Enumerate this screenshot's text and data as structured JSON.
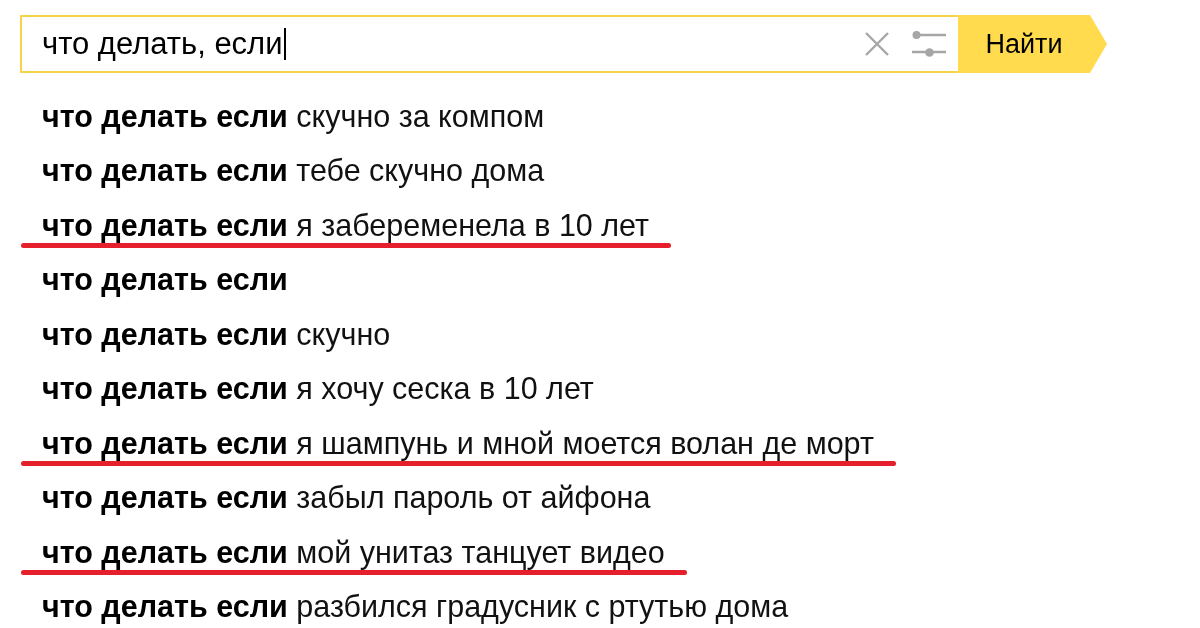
{
  "search": {
    "value": "что делать, если",
    "button": "Найти"
  },
  "suggestions": [
    {
      "text": "**что делать если** скучно за компом",
      "underlined": false
    },
    {
      "text": "**что делать если** тебе скучно дома",
      "underlined": false
    },
    {
      "text": "**что делать если** я забеременела в 10 лет",
      "underlined": true
    },
    {
      "text": "**что делать если**",
      "underlined": false
    },
    {
      "text": "**что делать если** скучно",
      "underlined": false
    },
    {
      "text": "**что делать если** я хочу сеска в 10 лет",
      "underlined": false
    },
    {
      "text": "**что делать если** я шампунь и мной моется волан де морт",
      "underlined": true
    },
    {
      "text": "**что делать если** забыл пароль от айфона",
      "underlined": false
    },
    {
      "text": "**что делать если** мой унитаз танцует видео",
      "underlined": true
    },
    {
      "text": "**что делать если** разбился градусник с ртутью дома",
      "underlined": false
    }
  ]
}
